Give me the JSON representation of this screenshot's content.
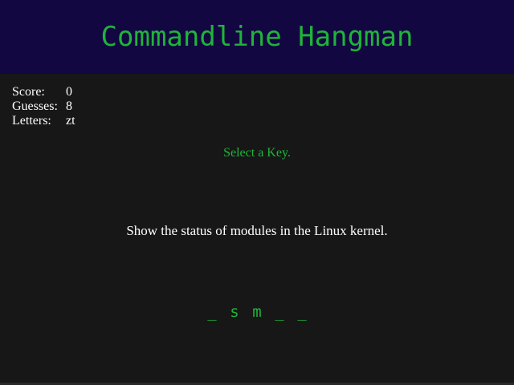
{
  "header": {
    "title": "Commandline Hangman"
  },
  "stats": {
    "score_label": "Score:",
    "score_value": "0",
    "guesses_label": "Guesses:",
    "guesses_value": "8",
    "letters_label": "Letters:",
    "letters_value": "zt"
  },
  "game": {
    "prompt": "Select a Key.",
    "clue": "Show the status of modules in the Linux kernel.",
    "word_slots": [
      "_",
      "s",
      "m",
      "_",
      "_"
    ]
  },
  "colors": {
    "header_bg": "#130742",
    "page_bg": "#171717",
    "accent_green": "#1fb43a",
    "text_white": "#ffffff"
  }
}
